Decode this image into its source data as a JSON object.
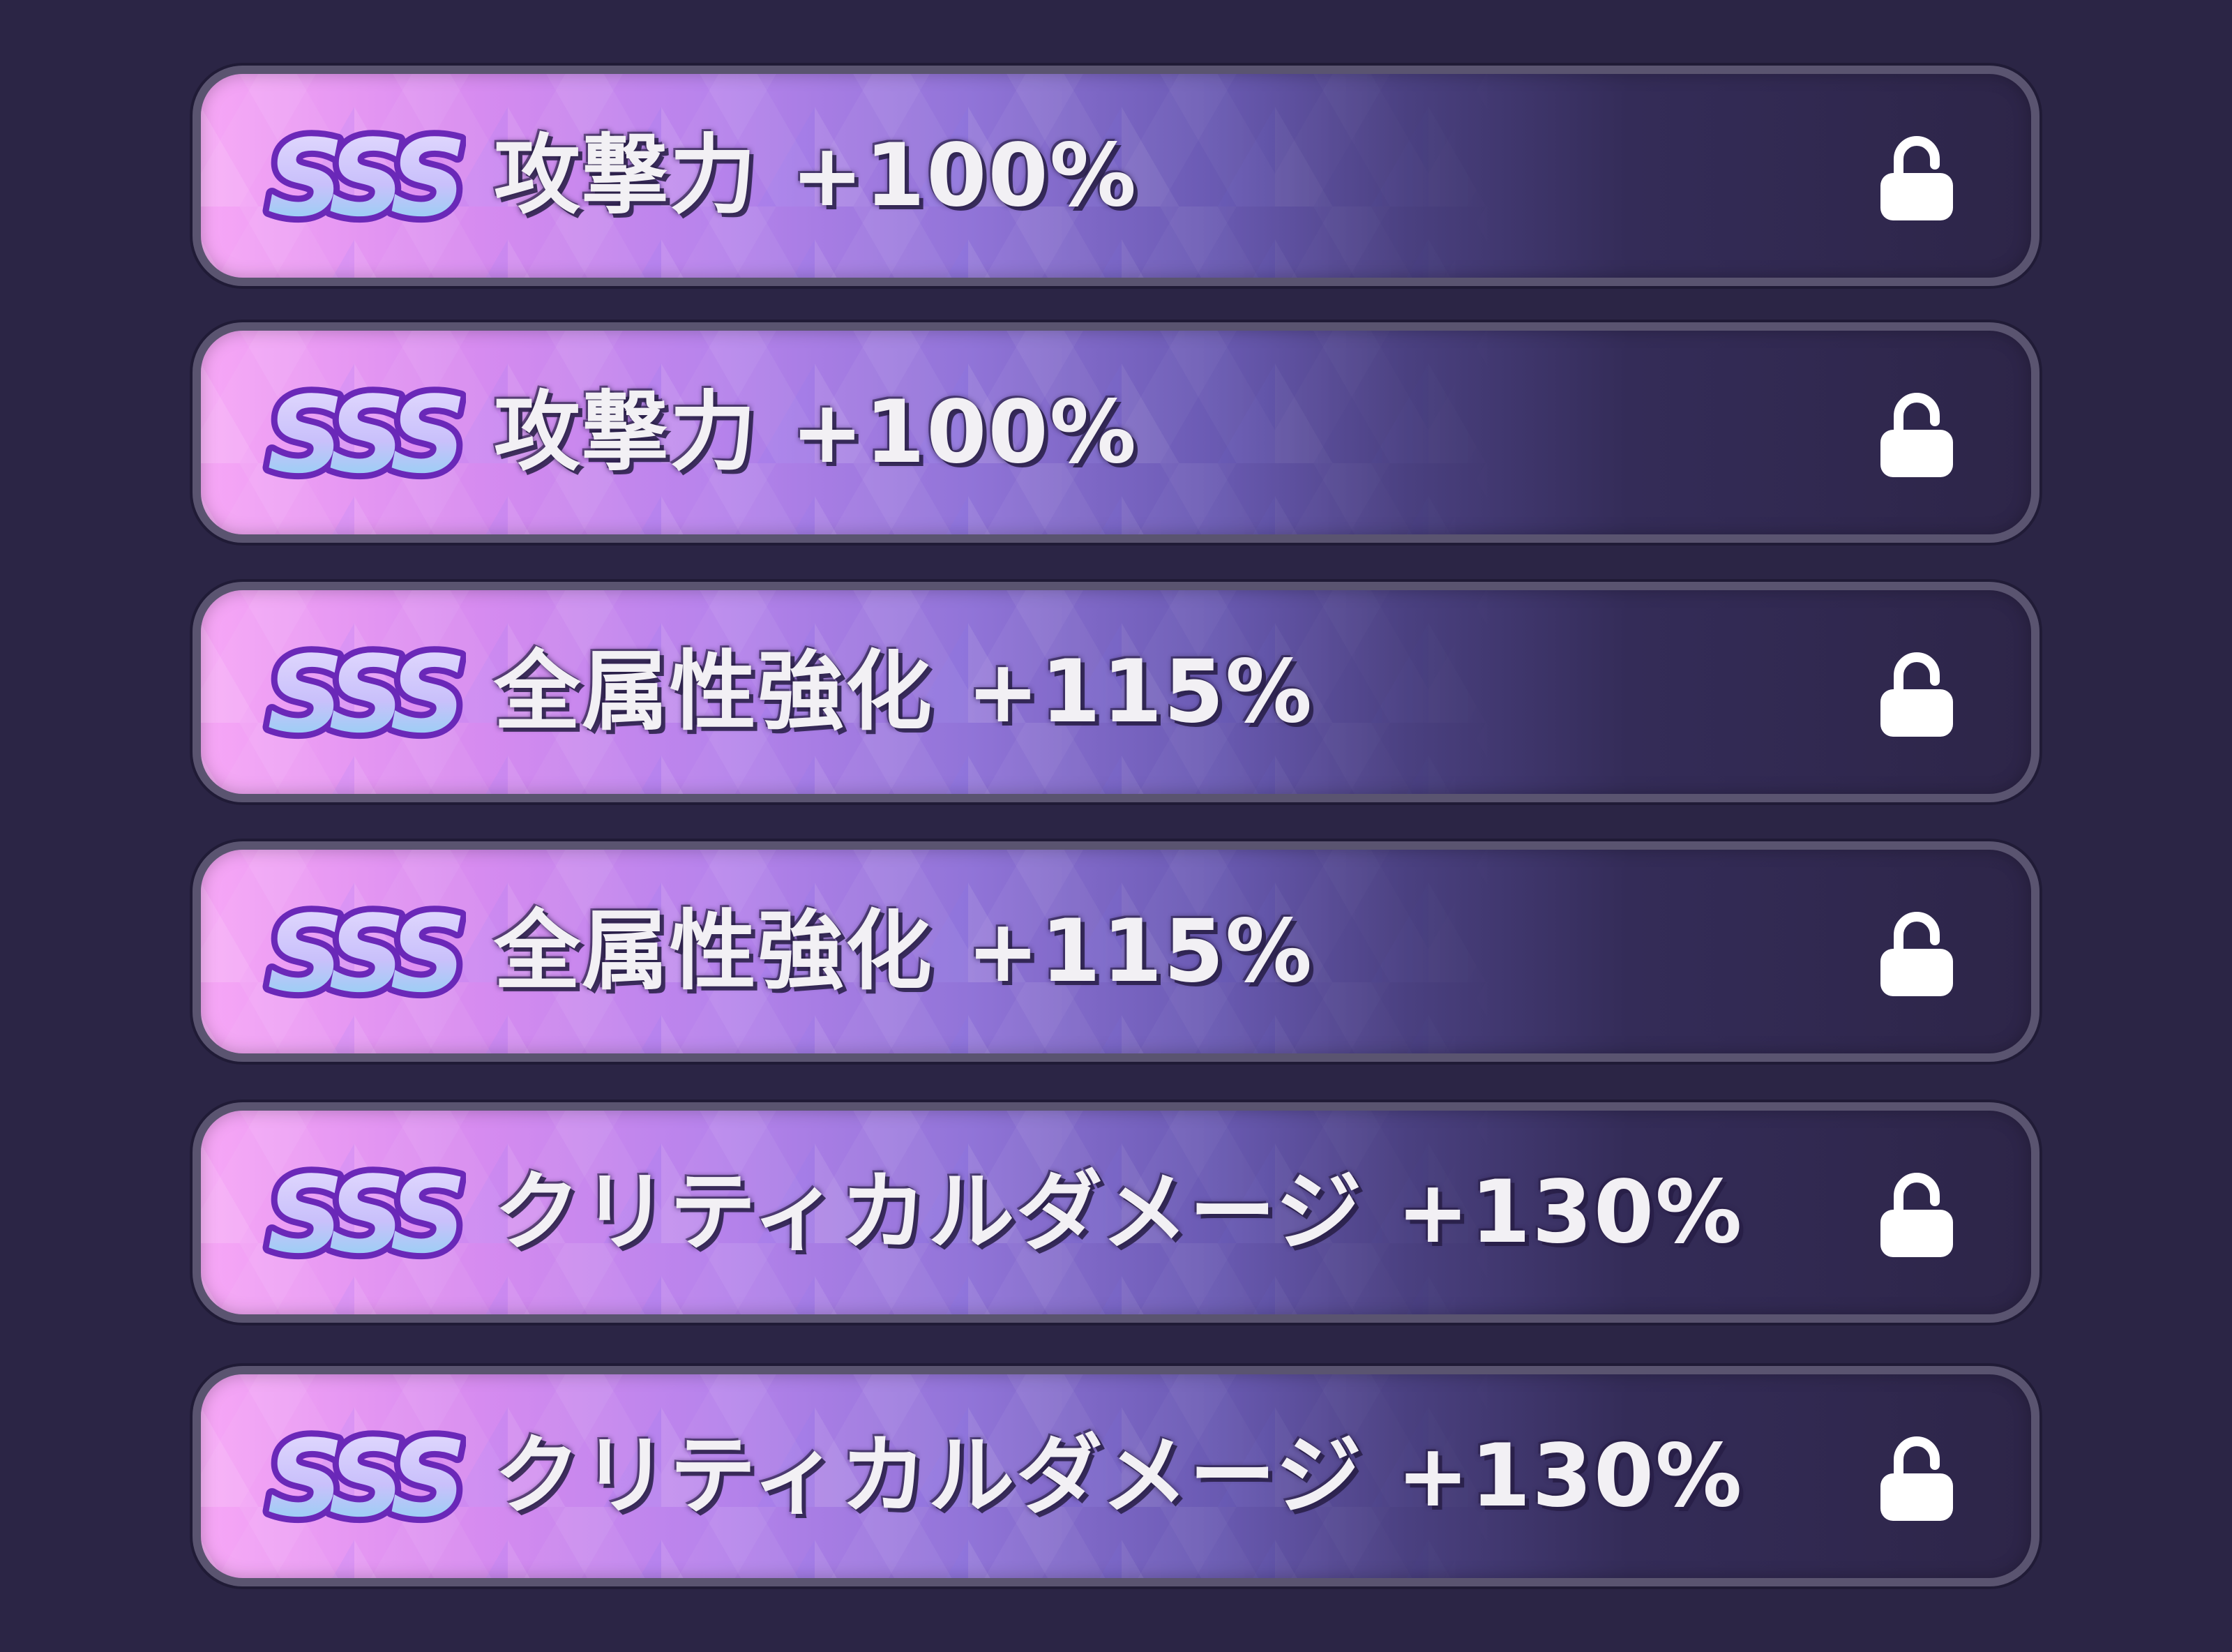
{
  "rows": [
    {
      "rank": "SSS",
      "stat": "攻撃力",
      "value": "+100%",
      "lock_icon": "unlocked-padlock-icon"
    },
    {
      "rank": "SSS",
      "stat": "攻撃力",
      "value": "+100%",
      "lock_icon": "unlocked-padlock-icon"
    },
    {
      "rank": "SSS",
      "stat": "全属性強化",
      "value": "+115%",
      "lock_icon": "unlocked-padlock-icon"
    },
    {
      "rank": "SSS",
      "stat": "全属性強化",
      "value": "+115%",
      "lock_icon": "unlocked-padlock-icon"
    },
    {
      "rank": "SSS",
      "stat": "クリティカルダメージ",
      "value": "+130%",
      "lock_icon": "unlocked-padlock-icon"
    },
    {
      "rank": "SSS",
      "stat": "クリティカルダメージ",
      "value": "+130%",
      "lock_icon": "unlocked-padlock-icon"
    }
  ],
  "colors": {
    "background": "#2b2545",
    "row_border": "#5a5470",
    "row_gradient_start": "#f7a7f6",
    "row_gradient_end": "#2d2548",
    "badge_fill_top": "#d9d3ff",
    "badge_fill_bottom": "#7fd8f0",
    "badge_outline": "#6a28b8",
    "text": "#f2f0f4",
    "lock_icon": "#ffffff"
  }
}
